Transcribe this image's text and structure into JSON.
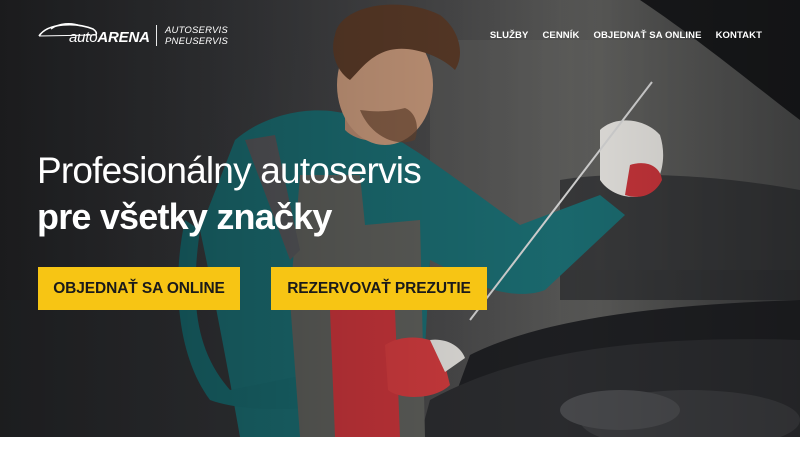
{
  "brand": {
    "name_light": "auto",
    "name_bold": "ARENA",
    "sub_line1": "AUTOSERVIS",
    "sub_line2": "PNEUSERVIS"
  },
  "nav": {
    "items": [
      {
        "label": "SLUŽBY"
      },
      {
        "label": "CENNÍK"
      },
      {
        "label": "OBJEDNAŤ SA ONLINE"
      },
      {
        "label": "KONTAKT"
      }
    ]
  },
  "hero": {
    "headline_line1": "Profesionálny autoservis",
    "headline_line2": "pre všetky značky",
    "cta_primary": "OBJEDNAŤ SA ONLINE",
    "cta_secondary": "REZERVOVAŤ PREZUTIE"
  },
  "colors": {
    "accent": "#f7c514",
    "text_on_dark": "#ffffff"
  }
}
